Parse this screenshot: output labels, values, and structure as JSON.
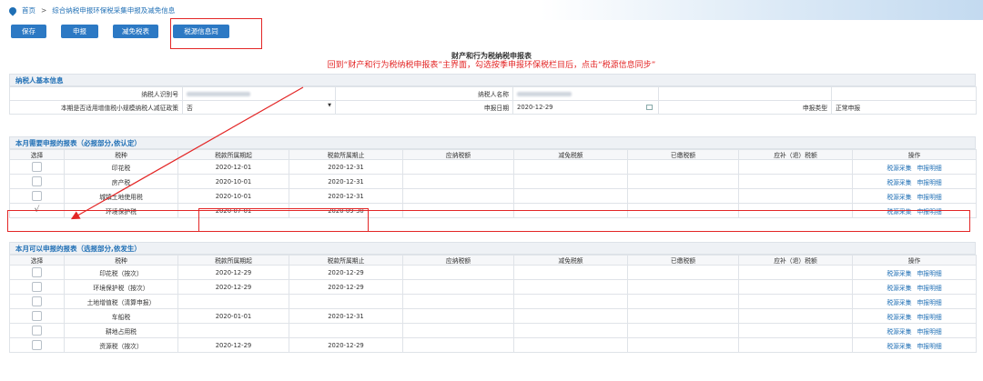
{
  "breadcrumb": {
    "home": "首页",
    "sep": ">",
    "current": "综合纳税申报环保税采集申报及减免信息"
  },
  "toolbar": {
    "save": "保存",
    "declare": "申报",
    "reduce": "减免税表",
    "sync": "税源信息同步"
  },
  "page_title": "财产和行为税纳税申报表",
  "instruction": "回到“财产和行为税纳税申报表”主界面，勾选按季申报环保税栏目后，点击“税源信息同步”",
  "taxpayer": {
    "header": "纳税人基本信息",
    "id_label": "纳税人识别号",
    "name_label": "纳税人名称",
    "policy_label": "本期是否适用增值税小规模纳税人减征政策",
    "policy_value": "否",
    "date_label": "申报日期",
    "date_value": "2020-12-29",
    "type_label": "申报类型",
    "type_value": "正常申报"
  },
  "columns": [
    "选择",
    "税种",
    "税款所属期起",
    "税款所属期止",
    "应纳税额",
    "减免税额",
    "已缴税额",
    "应补（退）税额",
    "操作"
  ],
  "actions": {
    "collect": "税源采集",
    "detail": "申报明细"
  },
  "required": {
    "header": "本月需要申报的报表（必报部分,依认定）",
    "rows": [
      {
        "checked": false,
        "name": "印花税",
        "start": "2020-12-01",
        "end": "2020-12-31"
      },
      {
        "checked": false,
        "name": "房产税",
        "start": "2020-10-01",
        "end": "2020-12-31"
      },
      {
        "checked": false,
        "name": "城镇土地使用税",
        "start": "2020-10-01",
        "end": "2020-12-31"
      },
      {
        "checked": true,
        "name": "环境保护税",
        "start": "2020-07-01",
        "end": "2020-09-30"
      }
    ]
  },
  "optional": {
    "header": "本月可以申报的报表（选报部分,依发生）",
    "rows": [
      {
        "checked": false,
        "name": "印花税（按次）",
        "start": "2020-12-29",
        "end": "2020-12-29"
      },
      {
        "checked": false,
        "name": "环境保护税（按次）",
        "start": "2020-12-29",
        "end": "2020-12-29"
      },
      {
        "checked": false,
        "name": "土地增值税（清算申报）",
        "start": "",
        "end": ""
      },
      {
        "checked": false,
        "name": "车船税",
        "start": "2020-01-01",
        "end": "2020-12-31"
      },
      {
        "checked": false,
        "name": "耕地占用税",
        "start": "",
        "end": ""
      },
      {
        "checked": false,
        "name": "资源税（按次）",
        "start": "2020-12-29",
        "end": "2020-12-29"
      }
    ]
  },
  "check_mark": "√",
  "colors": {
    "accent": "#2c79c4",
    "annotation": "#e32626",
    "link": "#1f6fb5"
  }
}
